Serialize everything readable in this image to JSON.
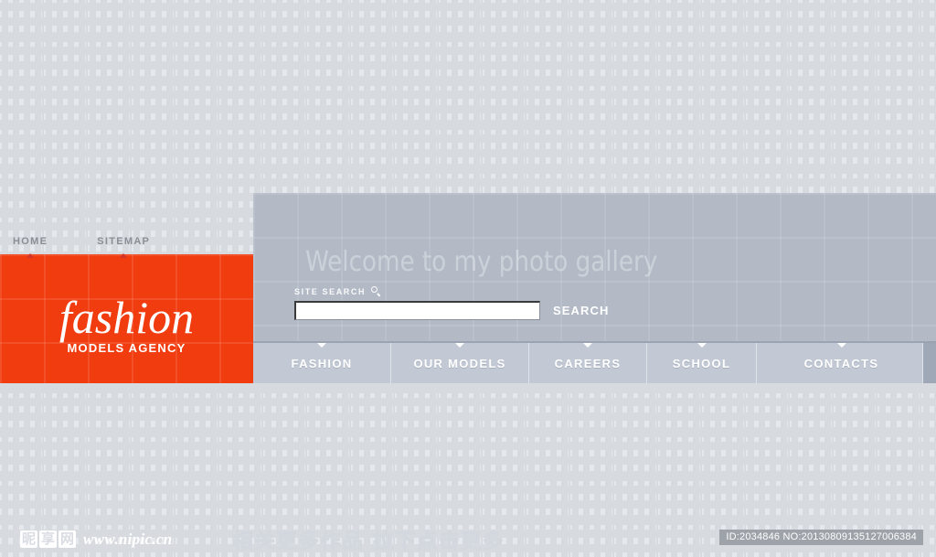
{
  "site": {
    "welcome_text": "Welcome to my photo gallery"
  },
  "topnav": {
    "items": [
      {
        "label": "HOME"
      },
      {
        "label": "SITEMAP"
      }
    ]
  },
  "brand": {
    "name": "fashion",
    "tagline": "MODELS AGENCY",
    "color": "#f13c10"
  },
  "search": {
    "label": "SITE SEARCH",
    "icon": "magnifier-icon",
    "value": "",
    "placeholder": "",
    "button_label": "SEARCH"
  },
  "nav": {
    "items": [
      {
        "label": "FASHION"
      },
      {
        "label": "OUR MODELS"
      },
      {
        "label": "CAREERS"
      },
      {
        "label": "SCHOOL"
      },
      {
        "label": "CONTACTS"
      }
    ]
  },
  "footer": {
    "logo_chars": [
      "昵",
      "享",
      "网"
    ],
    "url": "www.nipic.cn",
    "promo_text": "相关更多作品 拉下点击更多",
    "id_badge": "ID:2034846 NO:20130809135127006384"
  },
  "theme": {
    "panel_gray": "#b3bac6",
    "nav_gray": "#c2c9d4",
    "page_bg": "#e5e8ec",
    "accent_red": "#f13c10"
  }
}
